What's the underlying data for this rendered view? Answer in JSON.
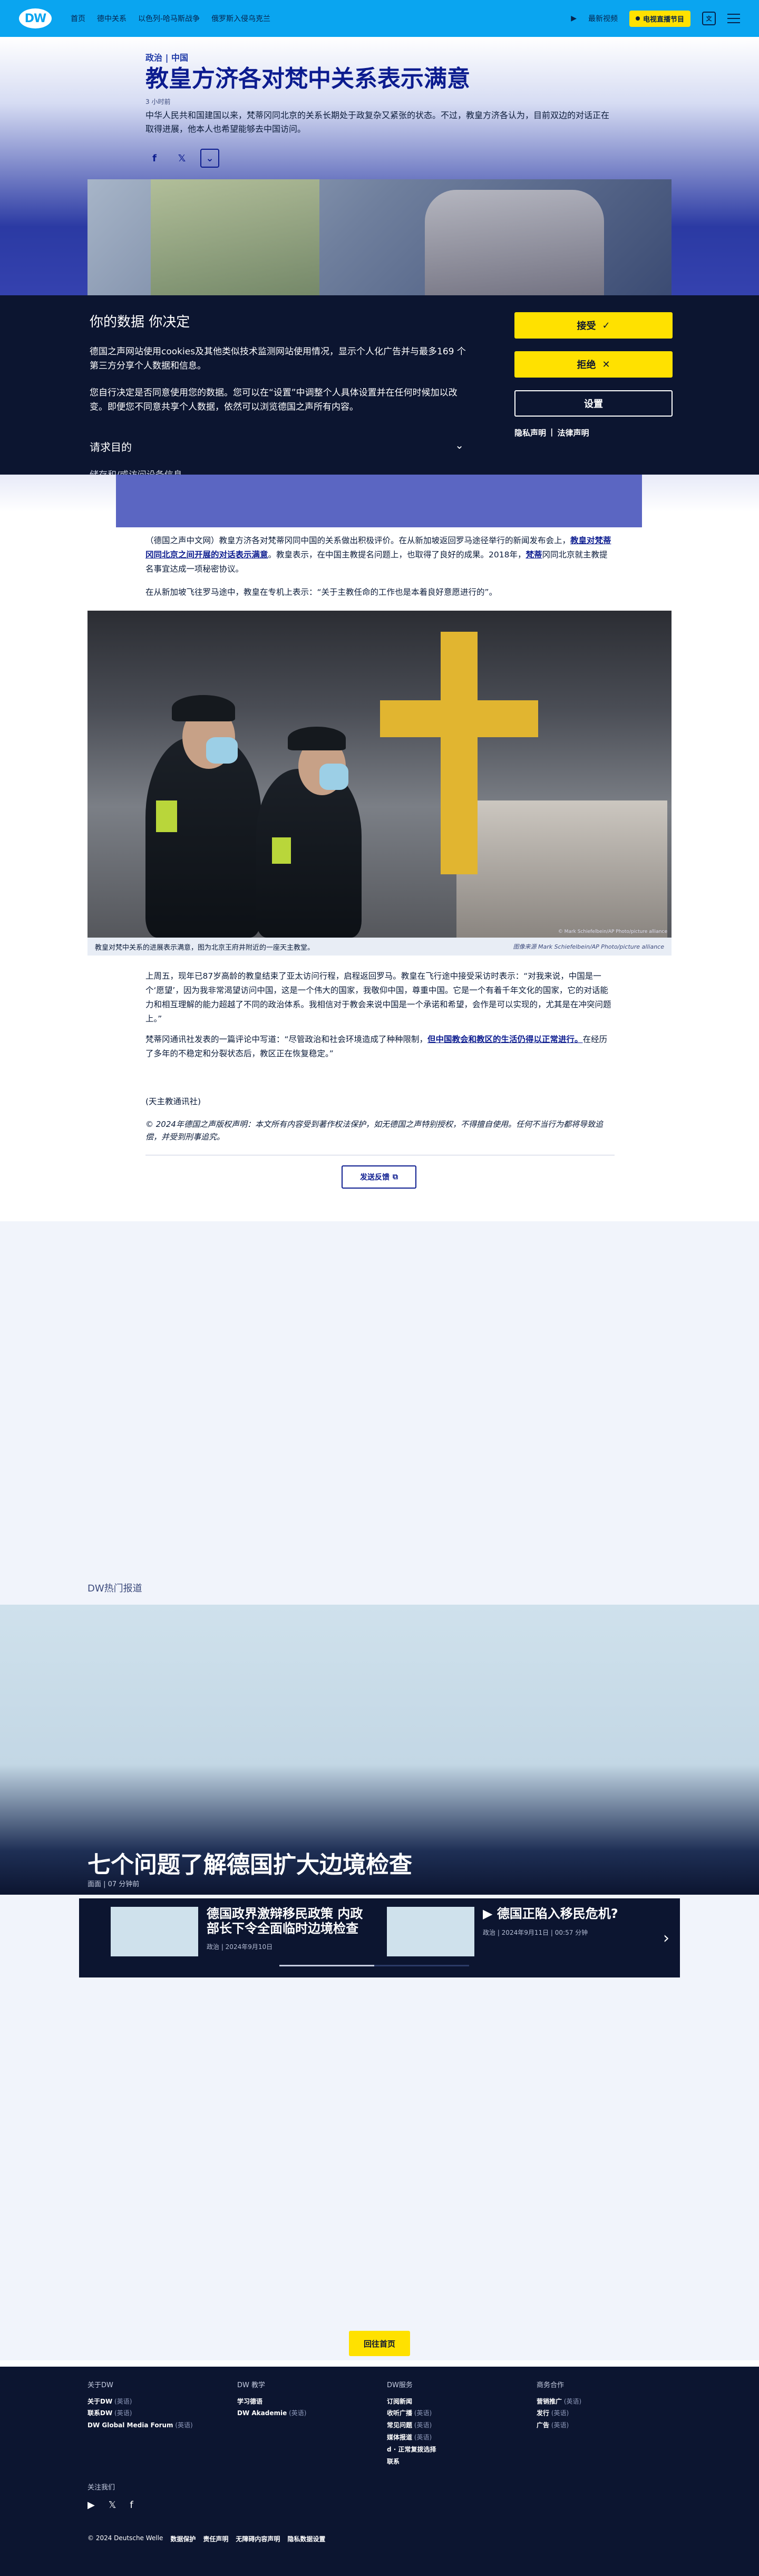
{
  "nav": {
    "logo": "DW",
    "links": [
      "首页",
      "德中关系",
      "以色列-哈马斯战争",
      "俄罗斯入侵乌克兰"
    ],
    "latest_video": "最新视频",
    "live_tv": "电视直播节目",
    "lang_icon": "文",
    "menu_icon": "menu-icon"
  },
  "article": {
    "kicker": "政治 | 中国",
    "title": "教皇方济各对梵中关系表示满意",
    "date": "3 小时前",
    "teaser": "中华人民共和国建国以来，梵蒂冈同北京的关系长期处于政复杂又紧张的状态。不过，教皇方济各认为，目前双边的对话正在取得进展，他本人也希望能够去中国访问。",
    "para1_a": "（德国之声中文网）教皇方济各对梵蒂冈同中国的关系做出积极评价。在从新加坡返回罗马途径举行的新闻发布会上，",
    "para1_link1": "教皇对梵蒂冈同北京之间开展的对话表示满意",
    "para1_b": "。教皇表示，在中国主教提名问题上，也取得了良好的成果。2018年，",
    "para1_link2": "梵蒂",
    "para1_c": "冈同北京就主教提名事宜达成一项秘密协议。",
    "para2": "在从新加坡飞往罗马途中，教皇在专机上表示：“关于主教任命的工作也是本着良好意愿进行的”。",
    "fig_caption": "教皇对梵中关系的进展表示满意，图为北京王府井附近的一座天主教堂。",
    "fig_credit": "图像来源 Mark Schiefelbein/AP Photo/picture alliance",
    "fig_overlay": "© Mark Schiefelbein/AP Photo/picture alliance",
    "para3": "上周五，现年已87岁高龄的教皇结束了亚太访问行程，启程返回罗马。教皇在飞行途中接受采访时表示：“对我来说，中国是一个‘愿望’，因为我非常渴望访问中国，这是一个伟大的国家，我敬仰中国，尊重中国。它是一个有着千年文化的国家，它的对话能力和相互理解的能力超越了不同的政治体系。我相信对于教会来说中国是一个承诺和希望，会作是可以实现的，尤其是在冲突问题上。”",
    "para4_a": "梵蒂冈通讯社发表的一篇评论中写道：“尽管政治和社会环境造成了种种限制，",
    "para4_link": "但中国教会和教区的生活仍得以正常进行。",
    "para4_b": "在经历了多年的不稳定和分裂状态后，教区正在恢复稳定。”",
    "source": "(天主教通讯社)",
    "copyright": "© 2024年德国之声版权声明：本文所有内容受到著作权法保护，如无德国之声特别授权，不得擅自使用。任何不当行为都将导致追偿，并受到刑事追究。",
    "feedback": "发送反馈"
  },
  "consent": {
    "title": "你的数据 你决定",
    "p1": "德国之声网站使用cookies及其他类似技术监测网站使用情况，显示个人化广告并与最多169 个第三方分享个人数据和信息。",
    "p2": "您自行决定是否同意使用您的数据。您可以在“设置”中调整个人具体设置并在任何时候加以改变。即便您不同意共享个人数据，依然可以浏览德国之声所有内容。",
    "purposes": "请求目的",
    "cut_text": "储存和/或访问设备信息",
    "accept": "接受",
    "reject": "拒绝",
    "settings": "设置",
    "privacy": "隐私声明",
    "legal": "法律声明"
  },
  "hot": {
    "label": "DW热门报道",
    "feature_title": "七个问题了解德国扩大边境检查",
    "feature_meta": "面面 | 07 分钟前",
    "cards": [
      {
        "title": "德国政界激辩移民政策 内政部长下令全面临时边境检查",
        "meta": "政治 | 2024年9月10日"
      },
      {
        "title": "德国正陷入移民危机?",
        "meta": "政治 | 2024年9月11日 | 00:57 分钟"
      }
    ],
    "home_btn": "回往首页"
  },
  "footer": {
    "cols": [
      {
        "title": "关于DW",
        "items": [
          [
            "关于DW",
            "(英语)"
          ],
          [
            "联系DW",
            "(英语)"
          ],
          [
            "DW Global Media Forum",
            "(英语)"
          ]
        ]
      },
      {
        "title": "DW 教学",
        "items": [
          [
            "学习德语",
            ""
          ],
          [
            "DW Akademie",
            "(英语)"
          ]
        ]
      },
      {
        "title": "DW服务",
        "items": [
          [
            "订阅新闻",
            ""
          ],
          [
            "收听广播",
            "(英语)"
          ],
          [
            "常见问题",
            "(英语)"
          ],
          [
            "媒体报道",
            "(英语)"
          ],
          [
            "d · 正常复拨选择",
            ""
          ],
          [
            "联系",
            ""
          ]
        ]
      },
      {
        "title": "商务合作",
        "items": [
          [
            "营销推广",
            "(英语)"
          ],
          [
            "发行",
            "(英语)"
          ],
          [
            "广告",
            "(英语)"
          ]
        ]
      }
    ],
    "follow": "关注我们",
    "bottom": [
      "© 2024 Deutsche Welle",
      "数据保护",
      "责任声明",
      "无障碍内容声明",
      "隐私数据设置"
    ]
  }
}
